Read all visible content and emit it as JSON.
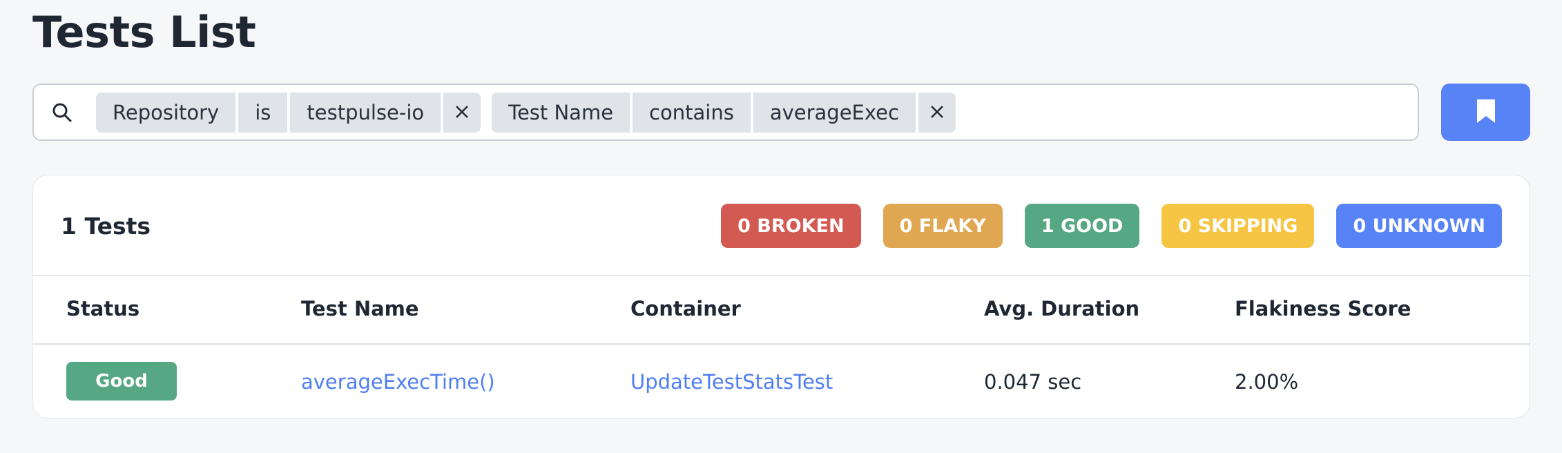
{
  "page": {
    "title": "Tests List"
  },
  "search": {
    "icon": "search-icon",
    "filters": [
      {
        "field": "Repository",
        "operator": "is",
        "value": "testpulse-io",
        "remove_icon": "close-icon"
      },
      {
        "field": "Test Name",
        "operator": "contains",
        "value": "averageExec",
        "remove_icon": "close-icon"
      }
    ]
  },
  "bookmark_button": {
    "icon": "bookmark-icon",
    "color": "#5783f7"
  },
  "summary": {
    "count_label": "1 Tests",
    "badges": [
      {
        "label": "0 BROKEN",
        "color": "#d25a52"
      },
      {
        "label": "0 FLAKY",
        "color": "#e0a752"
      },
      {
        "label": "1 GOOD",
        "color": "#56a784"
      },
      {
        "label": "0 SKIPPING",
        "color": "#f6c544"
      },
      {
        "label": "0 UNKNOWN",
        "color": "#5783f7"
      }
    ]
  },
  "table": {
    "columns": [
      "Status",
      "Test Name",
      "Container",
      "Avg. Duration",
      "Flakiness Score"
    ],
    "rows": [
      {
        "status": "Good",
        "test_name": "averageExecTime()",
        "container": "UpdateTestStatsTest",
        "avg_duration": "0.047 sec",
        "flakiness": "2.00%"
      }
    ]
  }
}
